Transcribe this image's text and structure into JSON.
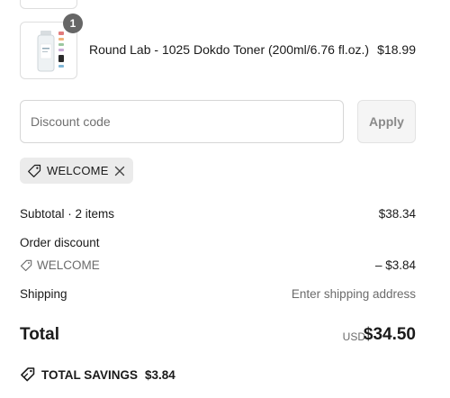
{
  "order_summary": {
    "line_items": [
      {
        "name": "Round Lab - 1025 Dokdo Toner (200ml/6.76 fl.oz.)",
        "quantity": "1",
        "price": "$18.99"
      }
    ],
    "discount": {
      "placeholder": "Discount code",
      "apply_label": "Apply",
      "applied_code": "WELCOME"
    },
    "subtotal": {
      "label": "Subtotal · 2 items",
      "value": "$38.34"
    },
    "order_discount": {
      "label": "Order discount",
      "code": "WELCOME",
      "value": "– $3.84"
    },
    "shipping": {
      "label": "Shipping",
      "value": "Enter shipping address"
    },
    "total": {
      "label": "Total",
      "currency": "USD",
      "value": "$34.50"
    },
    "savings": {
      "label": "TOTAL SAVINGS",
      "value": "$3.84"
    }
  },
  "icons": {
    "tag": "tag-icon",
    "remove": "close-icon",
    "savings": "savings-tag-icon"
  },
  "colors": {
    "badge": "#666666",
    "chip_background": "#ebebeb",
    "apply_button": "#f5f5f5",
    "muted_text": "#6b6b6b"
  }
}
